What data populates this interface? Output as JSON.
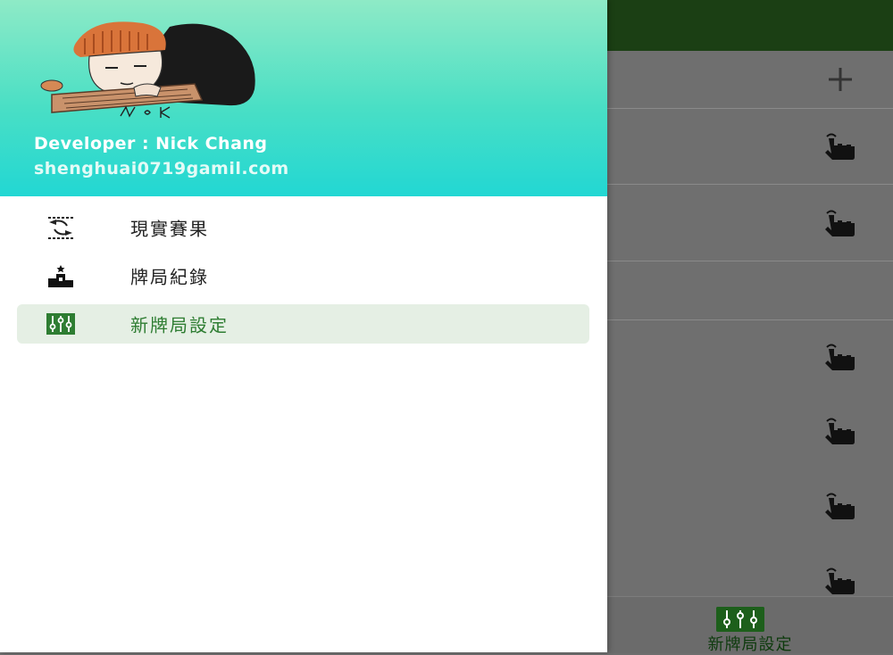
{
  "header": {
    "developer_line": "Developer : Nick Chang",
    "email_line": "shenghuai0719gamil.com",
    "avatar_signature": "Nick"
  },
  "drawer": {
    "items": [
      {
        "label": "現實賽果",
        "icon": "results-swap-icon",
        "active": false
      },
      {
        "label": "牌局紀錄",
        "icon": "podium-icon",
        "active": false
      },
      {
        "label": "新牌局設定",
        "icon": "sliders-icon",
        "active": true
      }
    ]
  },
  "bottom_nav": {
    "label": "新牌局設定",
    "icon": "sliders-icon"
  },
  "colors": {
    "accent_green": "#2e7d32",
    "topbar_green": "#1b3f14",
    "header_gradient_top": "#8eeac6",
    "header_gradient_bottom": "#22d7d3",
    "active_item_bg": "#e5efe4"
  }
}
